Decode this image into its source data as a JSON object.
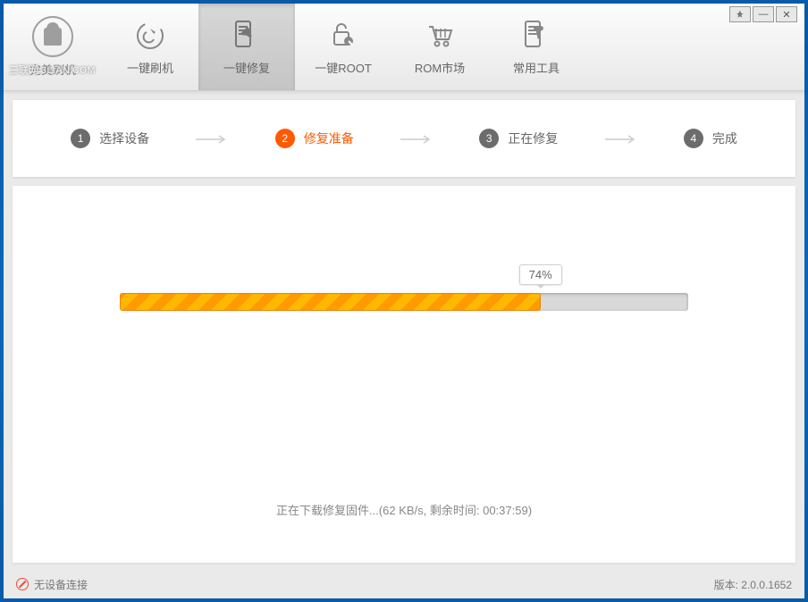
{
  "window_controls": {
    "pin": "📌",
    "min": "—",
    "close": "✕"
  },
  "watermark": "三联网 3LIAN.COM",
  "logo_label": "完美刷机",
  "nav": [
    {
      "label": "一键刷机"
    },
    {
      "label": "一键修复"
    },
    {
      "label": "一键ROOT"
    },
    {
      "label": "ROM市场"
    },
    {
      "label": "常用工具"
    }
  ],
  "steps": [
    {
      "num": "1",
      "label": "选择设备"
    },
    {
      "num": "2",
      "label": "修复准备"
    },
    {
      "num": "3",
      "label": "正在修复"
    },
    {
      "num": "4",
      "label": "完成"
    }
  ],
  "progress": {
    "percent": "74%"
  },
  "status": "正在下载修复固件...(62 KB/s, 剩余时间: 00:37:59)",
  "footer": {
    "no_device": "无设备连接",
    "version": "版本: 2.0.0.1652"
  }
}
